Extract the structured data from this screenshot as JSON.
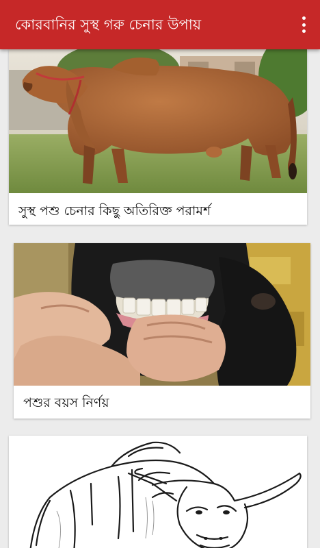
{
  "appbar": {
    "title": "কোরবানির সুস্থ গরু চেনার উপায়",
    "overflow_icon": "more-vert-icon"
  },
  "colors": {
    "appbar": "#c62828",
    "background": "#ececec",
    "card": "#ffffff"
  },
  "cards": [
    {
      "caption": "সুস্থ পশু চেনার কিছু অতিরিক্ত পরামর্শ",
      "image": "brown-bull-photo"
    },
    {
      "caption": "পশুর বয়স নির্ণয়",
      "image": "cow-teeth-photo"
    },
    {
      "caption": "",
      "image": "bull-sketch-drawing"
    }
  ]
}
